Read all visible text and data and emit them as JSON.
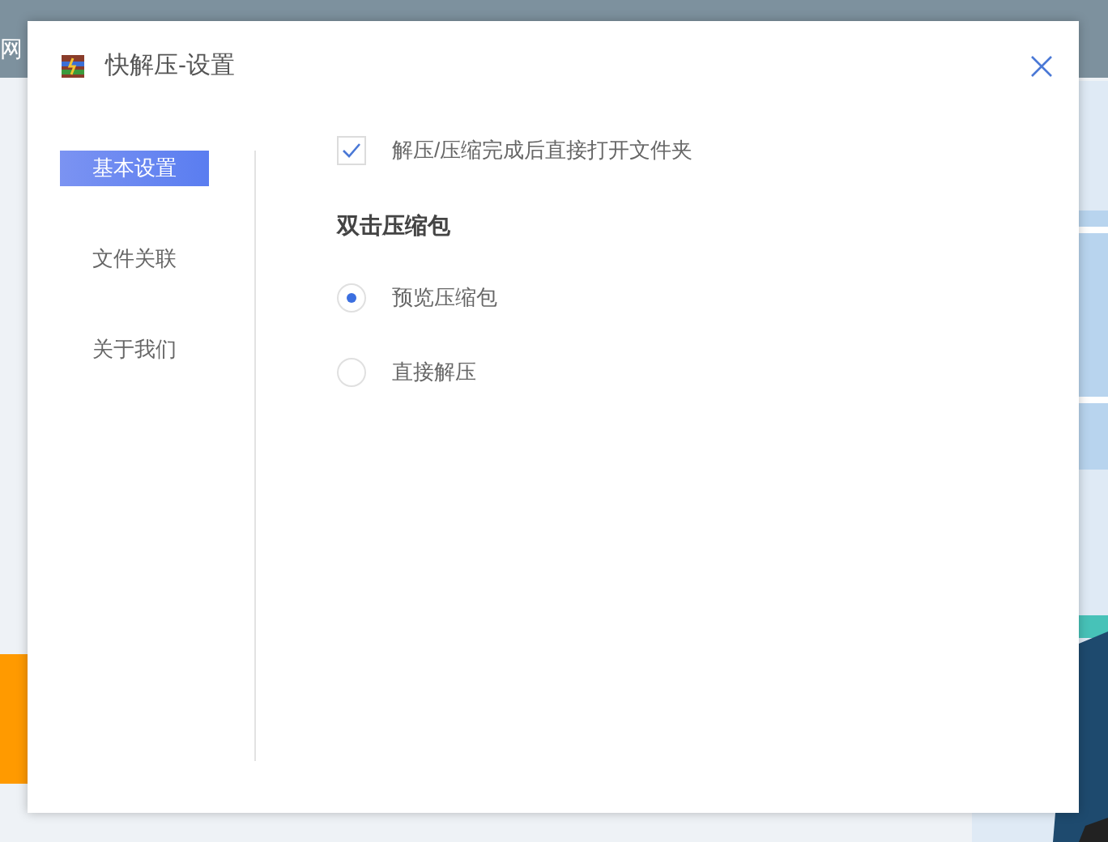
{
  "background": {
    "texts": [
      "网"
    ]
  },
  "window": {
    "title": "快解压-设置"
  },
  "sidebar": {
    "items": [
      {
        "label": "基本设置",
        "selected": true
      },
      {
        "label": "文件关联",
        "selected": false
      },
      {
        "label": "关于我们",
        "selected": false
      }
    ]
  },
  "settings": {
    "open_folder": {
      "label": "解压/压缩完成后直接打开文件夹",
      "checked": true
    },
    "double_click": {
      "heading": "双击压缩包",
      "options": [
        {
          "label": "预览压缩包",
          "selected": true
        },
        {
          "label": "直接解压",
          "selected": false
        }
      ]
    }
  }
}
